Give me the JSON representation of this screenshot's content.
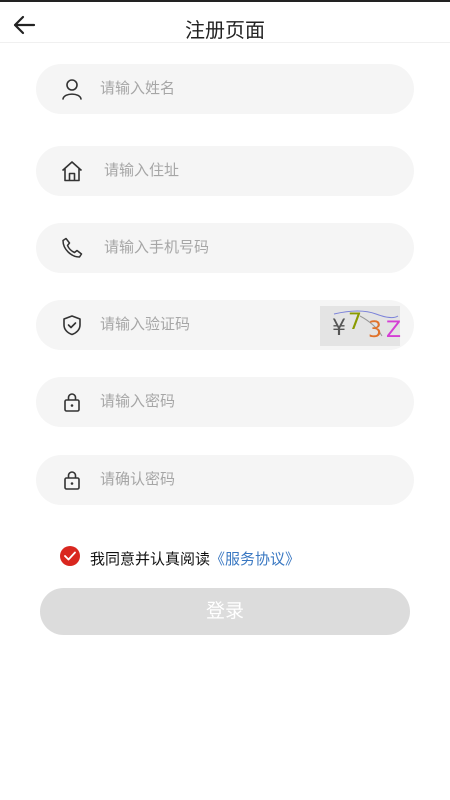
{
  "header": {
    "title": "注册页面"
  },
  "form": {
    "name_placeholder": "请输入姓名",
    "address_placeholder": "请输入住址",
    "phone_placeholder": "请输入手机号码",
    "code_placeholder": "请输入验证码",
    "password_placeholder": "请输入密码",
    "confirm_placeholder": "请确认密码",
    "captcha": {
      "chars": [
        "¥",
        "7",
        "3",
        "Z"
      ],
      "colors": [
        "#555555",
        "#8a9a00",
        "#e0722a",
        "#d43fd4"
      ]
    }
  },
  "agreement": {
    "text": "我同意并认真阅读",
    "link": "《服务协议》",
    "checked": true
  },
  "login_label": "登录",
  "colors": {
    "accent": "#d9271f",
    "link": "#3a78c2",
    "disabled_button": "#dcdcdc",
    "field_bg": "#f5f5f5"
  }
}
